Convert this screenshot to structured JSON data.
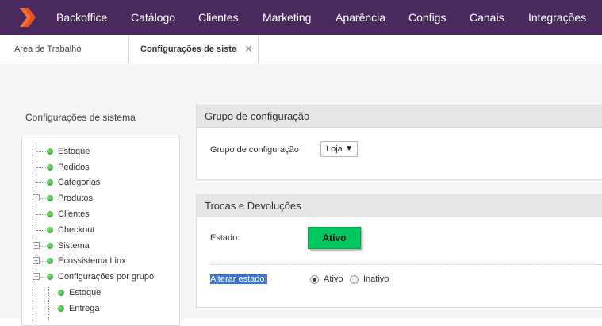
{
  "topnav": {
    "items": [
      "Backoffice",
      "Catálogo",
      "Clientes",
      "Marketing",
      "Aparência",
      "Configs",
      "Canais",
      "Integrações"
    ]
  },
  "tabs": {
    "home_label": "Área de Trabalho",
    "active_label": "Configurações de sistema",
    "close_glyph": "✕"
  },
  "sidebar": {
    "title": "Configurações de sistema",
    "tree": [
      {
        "label": "Estoque",
        "level": 0,
        "expander": ""
      },
      {
        "label": "Pedidos",
        "level": 0,
        "expander": ""
      },
      {
        "label": "Categorias",
        "level": 0,
        "expander": ""
      },
      {
        "label": "Produtos",
        "level": 0,
        "expander": "+"
      },
      {
        "label": "Clientes",
        "level": 0,
        "expander": ""
      },
      {
        "label": "Checkout",
        "level": 0,
        "expander": ""
      },
      {
        "label": "Sistema",
        "level": 0,
        "expander": "+"
      },
      {
        "label": "Ecossistema Linx",
        "level": 0,
        "expander": "+"
      },
      {
        "label": "Configurações por grupo",
        "level": 0,
        "expander": "−"
      },
      {
        "label": "Estoque",
        "level": 1,
        "expander": ""
      },
      {
        "label": "Entrega",
        "level": 1,
        "expander": ""
      }
    ]
  },
  "panel_group": {
    "title": "Grupo de configuração",
    "field_label": "Grupo de configuração",
    "select_value": "Loja"
  },
  "panel_returns": {
    "title": "Trocas e Devoluções",
    "status_label": "Estado:",
    "status_value": "Ativo",
    "change_label": "Alterar estado:",
    "options": [
      {
        "label": "Ativo",
        "selected": true
      },
      {
        "label": "Inativo",
        "selected": false
      }
    ]
  },
  "colors": {
    "topbar": "#4a2a5e",
    "logo": "#e8541c",
    "status_active": "#00c75f",
    "tree_dot": "#22a022"
  }
}
